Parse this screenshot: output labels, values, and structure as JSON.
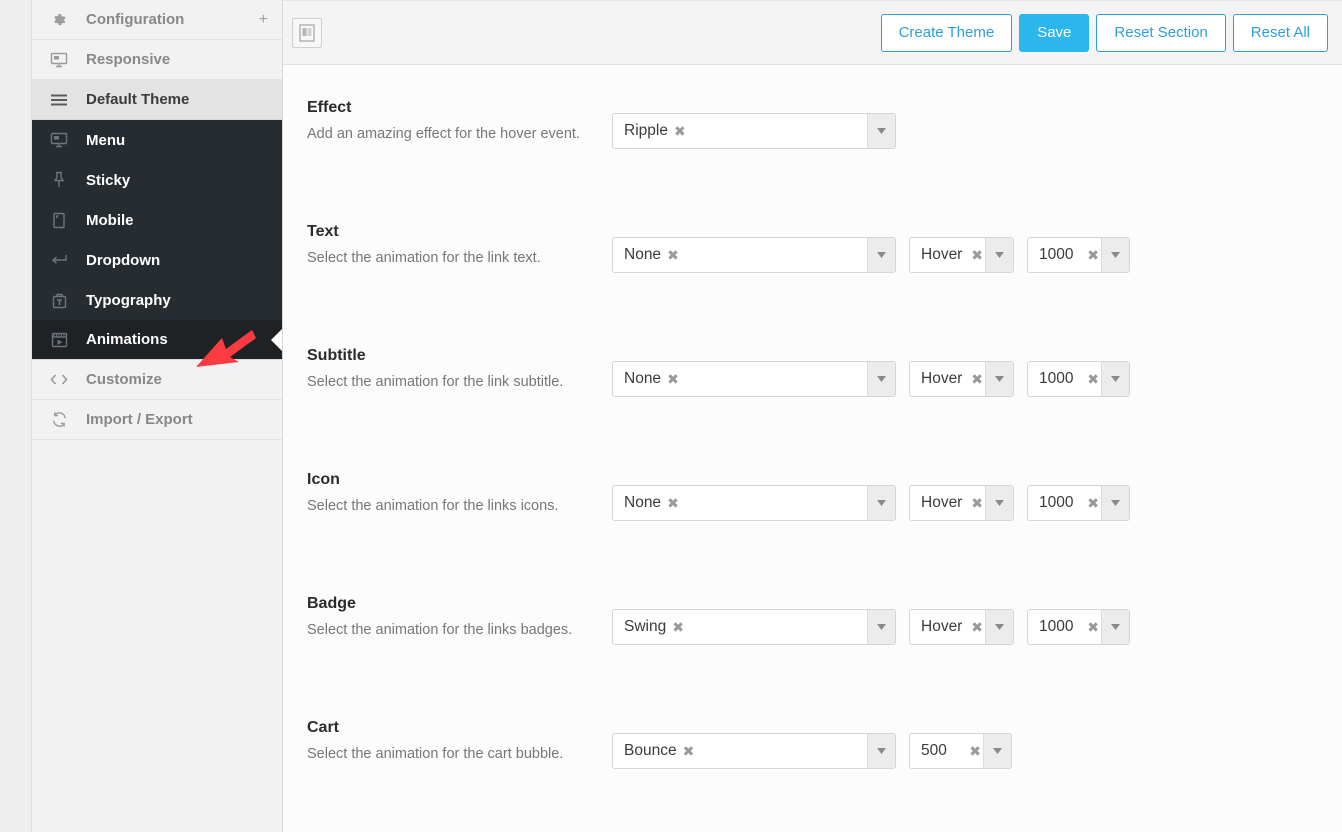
{
  "sidebar": {
    "items": [
      {
        "label": "Configuration",
        "icon": "gear-icon",
        "level": "top",
        "state": "normal",
        "accessory": "+"
      },
      {
        "label": "Responsive",
        "icon": "monitor-icon",
        "level": "top",
        "state": "normal",
        "accessory": ""
      },
      {
        "label": "Default Theme",
        "icon": "list-icon",
        "level": "top",
        "state": "selected",
        "accessory": ""
      },
      {
        "label": "Menu",
        "icon": "monitor-icon",
        "level": "sub",
        "state": "normal",
        "accessory": ""
      },
      {
        "label": "Sticky",
        "icon": "pin-icon",
        "level": "sub",
        "state": "normal",
        "accessory": ""
      },
      {
        "label": "Mobile",
        "icon": "mobile-icon",
        "level": "sub",
        "state": "normal",
        "accessory": ""
      },
      {
        "label": "Dropdown",
        "icon": "return-icon",
        "level": "sub",
        "state": "normal",
        "accessory": ""
      },
      {
        "label": "Typography",
        "icon": "typography-icon",
        "level": "sub",
        "state": "normal",
        "accessory": ""
      },
      {
        "label": "Animations",
        "icon": "animation-icon",
        "level": "sub",
        "state": "active",
        "accessory": ""
      },
      {
        "label": "Customize",
        "icon": "code-icon",
        "level": "top",
        "state": "normal",
        "accessory": ""
      },
      {
        "label": "Import / Export",
        "icon": "sync-icon",
        "level": "top",
        "state": "normal",
        "accessory": ""
      }
    ]
  },
  "annotation": {
    "arrow": "red-arrow-pointing-at-animations",
    "color": "#fb3b40"
  },
  "toolbar": {
    "device_toggle_icon": "layout-columns-icon",
    "create_theme_label": "Create Theme",
    "save_label": "Save",
    "reset_section_label": "Reset Section",
    "reset_all_label": "Reset All",
    "primary_color": "#2bb7ec",
    "outline_color": "#2d9fd9"
  },
  "main": {
    "rows": [
      {
        "title": "Effect",
        "description": "Add an amazing effect for the hover event.",
        "animation": {
          "value": "Ripple",
          "clear": "✖"
        },
        "trigger": null,
        "duration": null
      },
      {
        "title": "Text",
        "description": "Select the animation for the link text.",
        "animation": {
          "value": "None",
          "clear": "✖"
        },
        "trigger": {
          "value": "Hover",
          "clear": "✖"
        },
        "duration": {
          "value": "1000",
          "clear": "✖"
        }
      },
      {
        "title": "Subtitle",
        "description": "Select the animation for the link subtitle.",
        "animation": {
          "value": "None",
          "clear": "✖"
        },
        "trigger": {
          "value": "Hover",
          "clear": "✖"
        },
        "duration": {
          "value": "1000",
          "clear": "✖"
        }
      },
      {
        "title": "Icon",
        "description": "Select the animation for the links icons.",
        "animation": {
          "value": "None",
          "clear": "✖"
        },
        "trigger": {
          "value": "Hover",
          "clear": "✖"
        },
        "duration": {
          "value": "1000",
          "clear": "✖"
        }
      },
      {
        "title": "Badge",
        "description": "Select the animation for the links badges.",
        "animation": {
          "value": "Swing",
          "clear": "✖"
        },
        "trigger": {
          "value": "Hover",
          "clear": "✖"
        },
        "duration": {
          "value": "1000",
          "clear": "✖"
        }
      },
      {
        "title": "Cart",
        "description": "Select the animation for the cart bubble.",
        "animation": {
          "value": "Bounce",
          "clear": "✖"
        },
        "trigger": null,
        "duration": {
          "value": "500",
          "clear": "✖"
        }
      }
    ]
  }
}
